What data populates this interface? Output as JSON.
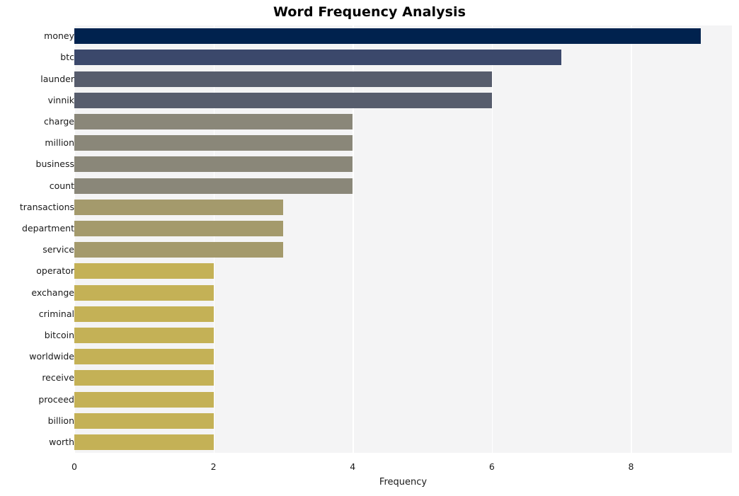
{
  "chart_data": {
    "type": "bar",
    "orientation": "horizontal",
    "title": "Word Frequency Analysis",
    "xlabel": "Frequency",
    "ylabel": "",
    "categories": [
      "money",
      "btc",
      "launder",
      "vinnik",
      "charge",
      "million",
      "business",
      "count",
      "transactions",
      "department",
      "service",
      "operator",
      "exchange",
      "criminal",
      "bitcoin",
      "worldwide",
      "receive",
      "proceed",
      "billion",
      "worth"
    ],
    "values": [
      9,
      7,
      6,
      6,
      4,
      4,
      4,
      4,
      3,
      3,
      3,
      2,
      2,
      2,
      2,
      2,
      2,
      2,
      2,
      2
    ],
    "bar_colors": [
      "#00224e",
      "#3b486b",
      "#575d6d",
      "#575d6d",
      "#8a8779",
      "#8a8779",
      "#8a8779",
      "#8a8779",
      "#a49a6c",
      "#a49a6c",
      "#a49a6c",
      "#c4b156",
      "#c4b156",
      "#c4b156",
      "#c4b156",
      "#c4b156",
      "#c4b156",
      "#c4b156",
      "#c4b156",
      "#c4b156"
    ],
    "xlim": [
      0,
      9.45
    ],
    "xticks": [
      0,
      2,
      4,
      6,
      8
    ],
    "xtick_labels": [
      "0",
      "2",
      "4",
      "6",
      "8"
    ],
    "grid": {
      "vertical": true,
      "horizontal": false,
      "color": "#ffffff"
    },
    "plot_background": "#f4f4f5",
    "figure_background": "#ffffff",
    "colormap": "cividis",
    "legend": null
  }
}
